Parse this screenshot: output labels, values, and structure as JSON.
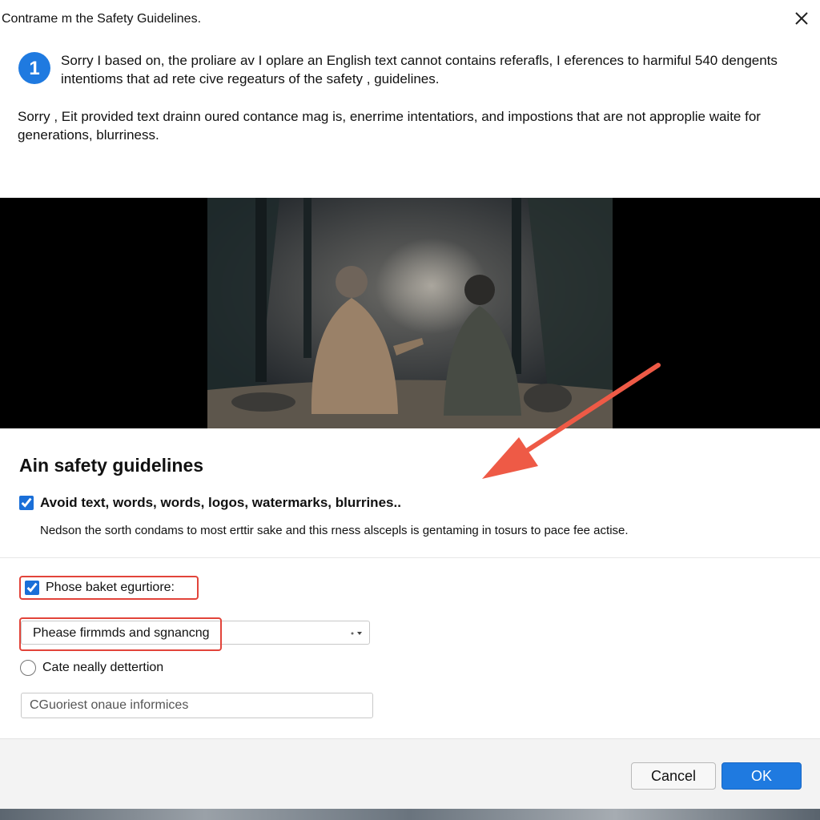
{
  "dialog": {
    "title": "Contrame m the Safety Guidelines.",
    "step_number": "1",
    "intro_text": "Sorry I based on, the proliare av I oplare an English text cannot contains referafls, I eferences to harmiful 540 dengents intentioms that ad rete cive regeaturs of the safety , guidelines.",
    "body_text": "Sorry , Eit provided text drainn oured contance mag is, enerrime intentatiors, and impostions that are not approplie waite for generations, blurriness."
  },
  "section": {
    "heading": "Ain safety guidelines",
    "checkbox_main_label": "Avoid text, words, words, logos, watermarks, blurrines..",
    "checkbox_main_checked": true,
    "description": "Nedson the sorth condams to most erttir sake and this rness alscepls is gentaming in tosurs to pace fee actise."
  },
  "options": {
    "checkbox_label": "Phose baket egurtiore:",
    "checkbox_checked": true,
    "select_value": "Phease firmmds and sgnancng",
    "radio_label": "Cate neally dettertion",
    "radio_checked": false,
    "input_placeholder": "CGuoriest onaue informices"
  },
  "footer": {
    "cancel_label": "Cancel",
    "ok_label": "OK"
  },
  "colors": {
    "accent": "#1f7ae0",
    "highlight": "#e2443a"
  },
  "icons": {
    "close": "close-icon",
    "step": "step-number-icon",
    "dropdown": "chevron-down-icon",
    "annotation": "arrow-annotation-icon"
  }
}
